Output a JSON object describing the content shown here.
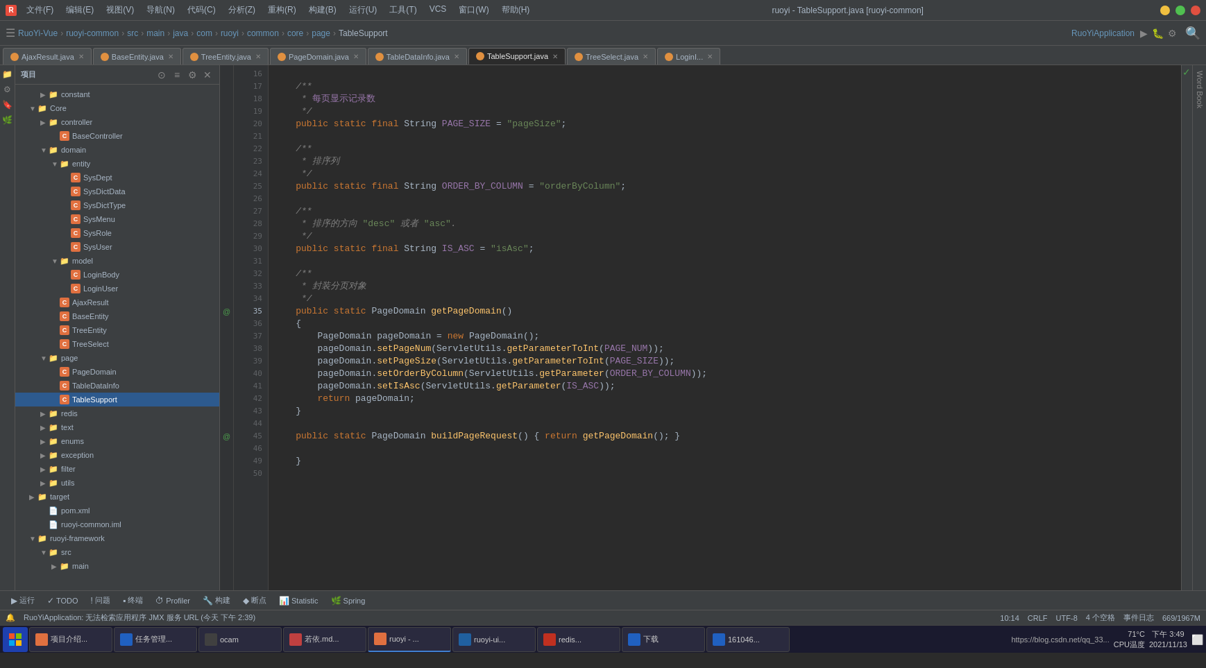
{
  "titleBar": {
    "logo": "R",
    "menus": [
      "文件(F)",
      "编辑(E)",
      "视图(V)",
      "导航(N)",
      "代码(C)",
      "分析(Z)",
      "重构(R)",
      "构建(B)",
      "运行(U)",
      "工具(T)",
      "VCS",
      "窗口(W)",
      "帮助(H)"
    ],
    "title": "ruoyi - TableSupport.java [ruoyi-common]",
    "btnMin": "—",
    "btnMax": "□",
    "btnClose": "✕"
  },
  "toolbar": {
    "breadcrumbs": [
      "RuoYi-Vue",
      "ruoyi-common",
      "src",
      "main",
      "java",
      "com",
      "ruoyi",
      "common",
      "core",
      "page",
      "TableSupport"
    ],
    "appName": "RuoYiApplication"
  },
  "tabs": [
    {
      "label": "AjaxResult.java",
      "active": false,
      "type": "orange"
    },
    {
      "label": "BaseEntity.java",
      "active": false,
      "type": "orange"
    },
    {
      "label": "TreeEntity.java",
      "active": false,
      "type": "orange"
    },
    {
      "label": "PageDomain.java",
      "active": false,
      "type": "orange"
    },
    {
      "label": "TableDataInfo.java",
      "active": false,
      "type": "orange"
    },
    {
      "label": "TableSupport.java",
      "active": true,
      "type": "orange"
    },
    {
      "label": "TreeSelect.java",
      "active": false,
      "type": "orange"
    },
    {
      "label": "LoginI...",
      "active": false,
      "type": "orange"
    }
  ],
  "sidebar": {
    "title": "项目",
    "tree": [
      {
        "indent": 2,
        "arrow": "▶",
        "icon": "folder",
        "label": "constant",
        "type": "folder"
      },
      {
        "indent": 1,
        "arrow": "▼",
        "icon": "folder",
        "label": "Core",
        "type": "folder"
      },
      {
        "indent": 2,
        "arrow": "▶",
        "icon": "folder",
        "label": "controller",
        "type": "folder"
      },
      {
        "indent": 3,
        "arrow": "",
        "icon": "class",
        "label": "BaseController",
        "type": "class"
      },
      {
        "indent": 2,
        "arrow": "▼",
        "icon": "folder",
        "label": "domain",
        "type": "folder"
      },
      {
        "indent": 3,
        "arrow": "▼",
        "icon": "folder",
        "label": "entity",
        "type": "folder"
      },
      {
        "indent": 4,
        "arrow": "",
        "icon": "class",
        "label": "SysDept",
        "type": "class"
      },
      {
        "indent": 4,
        "arrow": "",
        "icon": "class",
        "label": "SysDictData",
        "type": "class"
      },
      {
        "indent": 4,
        "arrow": "",
        "icon": "class",
        "label": "SysDictType",
        "type": "class"
      },
      {
        "indent": 4,
        "arrow": "",
        "icon": "class",
        "label": "SysMenu",
        "type": "class"
      },
      {
        "indent": 4,
        "arrow": "",
        "icon": "class",
        "label": "SysRole",
        "type": "class"
      },
      {
        "indent": 4,
        "arrow": "",
        "icon": "class",
        "label": "SysUser",
        "type": "class"
      },
      {
        "indent": 3,
        "arrow": "▼",
        "icon": "folder",
        "label": "model",
        "type": "folder"
      },
      {
        "indent": 4,
        "arrow": "",
        "icon": "class",
        "label": "LoginBody",
        "type": "class"
      },
      {
        "indent": 4,
        "arrow": "",
        "icon": "class",
        "label": "LoginUser",
        "type": "class"
      },
      {
        "indent": 3,
        "arrow": "",
        "icon": "class",
        "label": "AjaxResult",
        "type": "class"
      },
      {
        "indent": 3,
        "arrow": "",
        "icon": "class",
        "label": "BaseEntity",
        "type": "class"
      },
      {
        "indent": 3,
        "arrow": "",
        "icon": "class",
        "label": "TreeEntity",
        "type": "class"
      },
      {
        "indent": 3,
        "arrow": "",
        "icon": "class",
        "label": "TreeSelect",
        "type": "class"
      },
      {
        "indent": 2,
        "arrow": "▼",
        "icon": "folder",
        "label": "page",
        "type": "folder"
      },
      {
        "indent": 3,
        "arrow": "",
        "icon": "class",
        "label": "PageDomain",
        "type": "class"
      },
      {
        "indent": 3,
        "arrow": "",
        "icon": "class",
        "label": "TableDataInfo",
        "type": "class"
      },
      {
        "indent": 3,
        "arrow": "",
        "icon": "class",
        "label": "TableSupport",
        "type": "class",
        "selected": true
      },
      {
        "indent": 2,
        "arrow": "▶",
        "icon": "folder",
        "label": "redis",
        "type": "folder"
      },
      {
        "indent": 2,
        "arrow": "▶",
        "icon": "folder",
        "label": "text",
        "type": "folder"
      },
      {
        "indent": 2,
        "arrow": "▶",
        "icon": "folder",
        "label": "enums",
        "type": "folder"
      },
      {
        "indent": 2,
        "arrow": "▶",
        "icon": "folder",
        "label": "exception",
        "type": "folder"
      },
      {
        "indent": 2,
        "arrow": "▶",
        "icon": "folder",
        "label": "filter",
        "type": "folder"
      },
      {
        "indent": 2,
        "arrow": "▶",
        "icon": "folder",
        "label": "utils",
        "type": "folder"
      },
      {
        "indent": 1,
        "arrow": "▶",
        "icon": "folder",
        "label": "target",
        "type": "folder"
      },
      {
        "indent": 2,
        "arrow": "",
        "icon": "xml",
        "label": "pom.xml",
        "type": "xml"
      },
      {
        "indent": 2,
        "arrow": "",
        "icon": "iml",
        "label": "ruoyi-common.iml",
        "type": "iml"
      },
      {
        "indent": 1,
        "arrow": "▼",
        "icon": "folder",
        "label": "ruoyi-framework",
        "type": "folder"
      },
      {
        "indent": 2,
        "arrow": "▼",
        "icon": "folder",
        "label": "src",
        "type": "folder"
      },
      {
        "indent": 3,
        "arrow": "▶",
        "icon": "folder",
        "label": "main",
        "type": "folder"
      }
    ]
  },
  "codeLines": [
    {
      "num": 16,
      "gutter": "",
      "content": ""
    },
    {
      "num": 17,
      "gutter": "",
      "content": "    /**"
    },
    {
      "num": 18,
      "gutter": "",
      "content": "     * 每页显示记录数"
    },
    {
      "num": 19,
      "gutter": "",
      "content": "     */"
    },
    {
      "num": 20,
      "gutter": "",
      "content": "    public static final String PAGE_SIZE = \"pageSize\";"
    },
    {
      "num": 21,
      "gutter": "",
      "content": ""
    },
    {
      "num": 22,
      "gutter": "",
      "content": "    /**"
    },
    {
      "num": 23,
      "gutter": "",
      "content": "     * 排序列"
    },
    {
      "num": 24,
      "gutter": "",
      "content": "     */"
    },
    {
      "num": 25,
      "gutter": "",
      "content": "    public static final String ORDER_BY_COLUMN = \"orderByColumn\";"
    },
    {
      "num": 26,
      "gutter": "",
      "content": ""
    },
    {
      "num": 27,
      "gutter": "",
      "content": "    /**"
    },
    {
      "num": 28,
      "gutter": "",
      "content": "     * 排序的方向 \"desc\" 或者 \"asc\"."
    },
    {
      "num": 29,
      "gutter": "",
      "content": "     */"
    },
    {
      "num": 30,
      "gutter": "",
      "content": "    public static final String IS_ASC = \"isAsc\";"
    },
    {
      "num": 31,
      "gutter": "",
      "content": ""
    },
    {
      "num": 32,
      "gutter": "",
      "content": "    /**"
    },
    {
      "num": 33,
      "gutter": "",
      "content": "     * 封装分页对象"
    },
    {
      "num": 34,
      "gutter": "",
      "content": "     */"
    },
    {
      "num": 35,
      "gutter": "@",
      "content": "    public static PageDomain getPageDomain()"
    },
    {
      "num": 36,
      "gutter": "",
      "content": "    {"
    },
    {
      "num": 37,
      "gutter": "",
      "content": "        PageDomain pageDomain = new PageDomain();"
    },
    {
      "num": 38,
      "gutter": "",
      "content": "        pageDomain.setPageNum(ServletUtils.getParameterToInt(PAGE_NUM));"
    },
    {
      "num": 39,
      "gutter": "",
      "content": "        pageDomain.setPageSize(ServletUtils.getParameterToInt(PAGE_SIZE));"
    },
    {
      "num": 40,
      "gutter": "",
      "content": "        pageDomain.setOrderByColumn(ServletUtils.getParameter(ORDER_BY_COLUMN));"
    },
    {
      "num": 41,
      "gutter": "",
      "content": "        pageDomain.setIsAsc(ServletUtils.getParameter(IS_ASC));"
    },
    {
      "num": 42,
      "gutter": "",
      "content": "        return pageDomain;"
    },
    {
      "num": 43,
      "gutter": "",
      "content": "    }"
    },
    {
      "num": 44,
      "gutter": "",
      "content": ""
    },
    {
      "num": 45,
      "gutter": "@",
      "content": "    public static PageDomain buildPageRequest() { return getPageDomain(); }"
    },
    {
      "num": 46,
      "gutter": "",
      "content": ""
    },
    {
      "num": 49,
      "gutter": "",
      "content": "    }"
    },
    {
      "num": 50,
      "gutter": "",
      "content": ""
    }
  ],
  "bottomToolbar": {
    "items": [
      {
        "icon": "▶",
        "label": "运行"
      },
      {
        "icon": "✓",
        "label": "TODO"
      },
      {
        "icon": "?",
        "label": "问题"
      },
      {
        "icon": "■",
        "label": "终端"
      },
      {
        "icon": "⏱",
        "label": "Profiler"
      },
      {
        "icon": "🔧",
        "label": "构建"
      },
      {
        "icon": "◆",
        "label": "断点"
      },
      {
        "icon": "📊",
        "label": "Statistic"
      },
      {
        "icon": "🌿",
        "label": "Spring"
      }
    ]
  },
  "statusBar": {
    "position": "10:14",
    "lineEnding": "CRLF",
    "encoding": "UTF-8",
    "indent": "4 个空格",
    "lines": "669/1967M",
    "eventLog": "事件日志"
  },
  "notification": {
    "text": "RuoYiApplication: 无法检索应用程序 JMX 服务 URL (今天 下午 2:39)"
  },
  "taskbar": {
    "items": [
      {
        "label": "项目介绍...",
        "color": "#e07040"
      },
      {
        "label": "任务管理...",
        "color": "#2060c0"
      },
      {
        "label": "ocam",
        "color": "#404040"
      },
      {
        "label": "若依.md...",
        "color": "#c04040"
      },
      {
        "label": "ruoyi - ...",
        "color": "#e07040"
      },
      {
        "label": "ruoyi-ui...",
        "color": "#2060a0"
      },
      {
        "label": "redis...",
        "color": "#c03020"
      },
      {
        "label": "下载",
        "color": "#2060c0"
      },
      {
        "label": "161046...",
        "color": "#2060c0"
      }
    ],
    "clock": {
      "time": "下午 3:49",
      "date": "2021/11/13"
    },
    "temp": "71°C\nCPU温度",
    "url": "https://blog.csdn.net/qq_33..."
  }
}
